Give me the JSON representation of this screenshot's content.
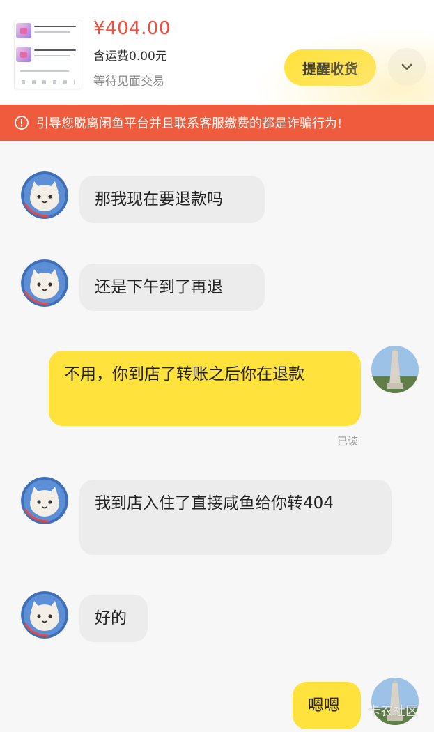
{
  "order": {
    "price": "¥404.00",
    "shipping": "含运费0.00元",
    "status": "等待见面交易",
    "remind_button": "提醒收货",
    "expand_icon": "chevron-down-icon"
  },
  "warning": {
    "icon": "info-circle-icon",
    "text": "引导您脱离闲鱼平台并且联系客服缴费的都是诈骗行为!"
  },
  "messages": [
    {
      "side": "in",
      "text": "那我现在要退款吗"
    },
    {
      "side": "in",
      "text": "还是下午到了再退"
    },
    {
      "side": "out",
      "text": "不用，你到店了转账之后你在退款",
      "receipt": "已读"
    },
    {
      "side": "in",
      "text": "我到店入住了直接咸鱼给你转404"
    },
    {
      "side": "in",
      "text": "好的"
    },
    {
      "side": "out",
      "text": "嗯嗯"
    }
  ],
  "watermark": "卡农社区",
  "colors": {
    "accent_yellow": "#ffe23c",
    "price_red": "#ee4d3c",
    "warning_orange": "#ee5c3d",
    "bubble_gray": "#ececec"
  }
}
